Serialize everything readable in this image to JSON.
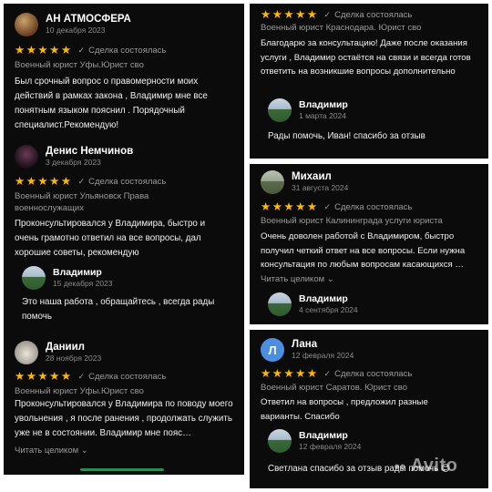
{
  "colors": {
    "star": "#ffb800",
    "panel_bg": "#0b0b0b",
    "muted": "#8a8a8a",
    "text": "#f0f0f0"
  },
  "deal_label": "Сделка состоялась",
  "stars_text": "★★★★★",
  "check_icon": "✓",
  "left_panel": {
    "reviews": [
      {
        "author": "АН АТМОСФЕРА",
        "date": "10 декабря 2023",
        "category": "Военный юрист Уфы.Юрист сво",
        "text": "Был срочный вопрос о правомерности моих действий в рамках закона , Владимир мне все понятным языком пояснил . Порядочный специалист.Рекомендую!"
      },
      {
        "author": "Денис Немчинов",
        "date": "3 декабря 2023",
        "category": "Военный юрист Ульяновск Права военнослужащих",
        "text": "Проконсультировался у Владимира, быстро и очень грамотно ответил на все вопросы, дал хорошие советы, рекомендую",
        "response": {
          "author": "Владимир",
          "date": "15 декабря 2023",
          "text": "Это наша работа , обращайтесь , всегда рады помочь"
        }
      },
      {
        "author": "Даниил",
        "date": "28 ноября 2023",
        "category": "Военный юрист Уфы.Юрист сво",
        "text": "Проконсультировался у Владимира по поводу моего увольнения , я после ранения , продолжать служить уже не в состоянии. Владимир мне пояс…",
        "more": "Читать целиком ⌄"
      }
    ]
  },
  "top_right": {
    "category": "Военный юрист Краснодара. Юрист сво",
    "text": "Благодарю за консультацию! Даже после оказания услуги , Владимир остаётся на связи и всегда готов ответить на возникшие вопросы дополнительно",
    "response": {
      "author": "Владимир",
      "date": "1 марта 2024",
      "text": "Рады помочь, Иван! спасибо за отзыв"
    }
  },
  "mid_right": {
    "author": "Михаил",
    "date": "31 августа 2024",
    "category": "Военный юрист Калининграда услуги юриста",
    "text": "Очень доволен работой с Владимиром, быстро получил четкий ответ на все вопросы. Если нужна консультация по любым вопросам касающихся …",
    "more": "Читать целиком ⌄",
    "response": {
      "author": "Владимир",
      "date": "4 сентября 2024"
    }
  },
  "bottom_right": {
    "avatar_letter": "Л",
    "author": "Лана",
    "date": "12 февраля 2024",
    "category": "Военный юрист Саратов. Юрист сво",
    "text": "Ответил на вопросы , предложил разные варианты. Спасибо",
    "response": {
      "author": "Владимир",
      "date": "12 февраля 2024",
      "text": "Светлана спасибо за отзыв рады помочь 😊"
    }
  },
  "watermark": "Avito"
}
